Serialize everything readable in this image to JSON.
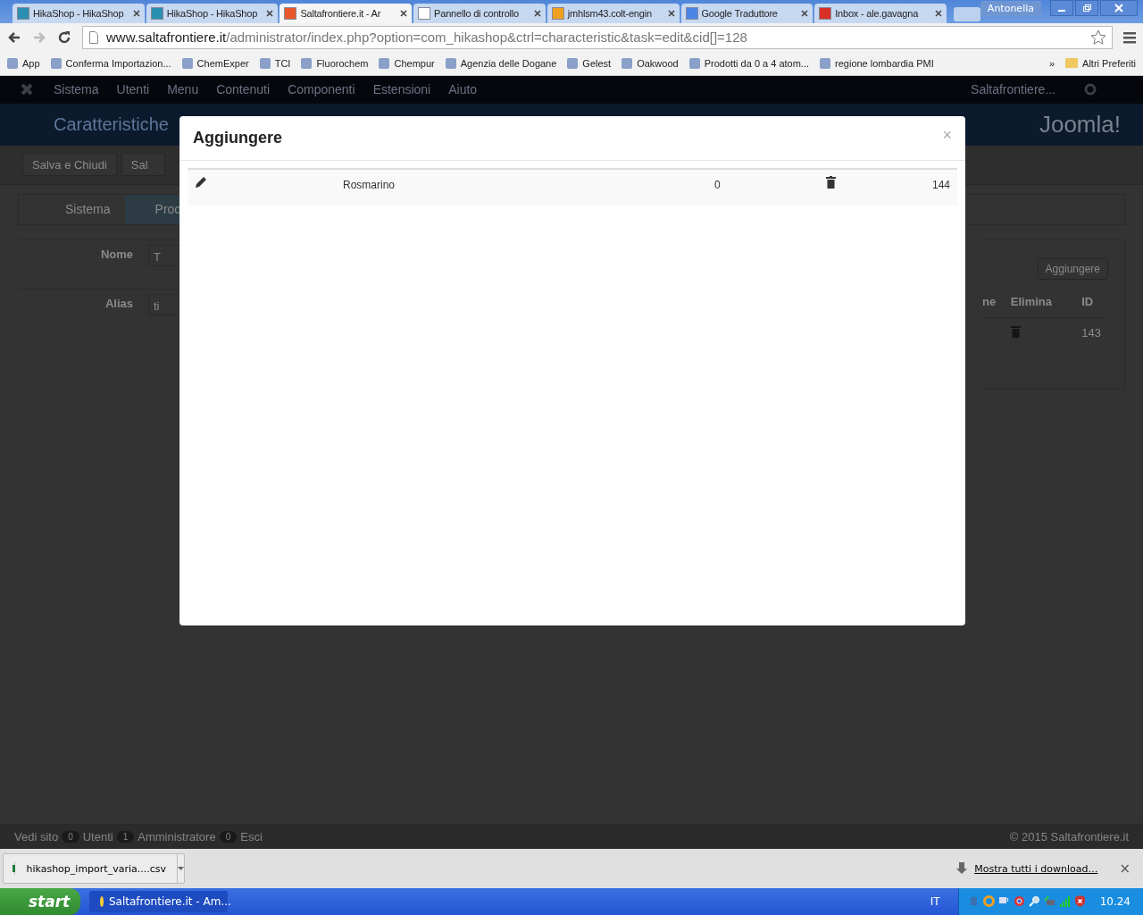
{
  "browser": {
    "tabs": [
      {
        "title": "HikaShop - HikaShop",
        "selected": false
      },
      {
        "title": "HikaShop - HikaShop",
        "selected": false
      },
      {
        "title": "Saltafrontiere.it - Ar",
        "selected": true
      },
      {
        "title": "Pannello di controllo",
        "selected": false
      },
      {
        "title": "jmhlsm43.colt-engin",
        "selected": false
      },
      {
        "title": "Google Traduttore",
        "selected": false
      },
      {
        "title": "Inbox - ale.gavagna",
        "selected": false
      }
    ],
    "profile": "Antonella",
    "url": {
      "host": "www.saltafrontiere.it",
      "path": "/administrator/index.php?option=com_hikashop&ctrl=characteristic&task=edit&cid[]=128"
    },
    "bookmarks": [
      "App",
      "Conferma Importazion...",
      "ChemExper",
      "TCI",
      "Fluorochem",
      "Chempur",
      "Agenzia delle Dogane",
      "Gelest",
      "Oakwood",
      "Prodotti da 0 a 4 atom...",
      "regione lombardia PMI"
    ],
    "bookmarks_more": "»",
    "other_bookmarks": "Altri Preferiti"
  },
  "admin": {
    "menu": [
      "Sistema",
      "Utenti",
      "Menu",
      "Contenuti",
      "Componenti",
      "Estensioni",
      "Aiuto"
    ],
    "site_link": "Saltafrontiere...",
    "page_title": "Caratteristiche",
    "logo": "Joomla!",
    "toolbar": [
      "Salva e Chiudi",
      "Sal"
    ],
    "tabs": [
      {
        "label": "Sistema",
        "selected": false
      },
      {
        "label": "Proc",
        "selected": true
      }
    ],
    "form": [
      {
        "label": "Nome",
        "value": "T"
      },
      {
        "label": "Alias",
        "value": "ti"
      }
    ],
    "values_panel": {
      "add_button": "Aggiungere",
      "columns": [
        "ne",
        "Elimina",
        "ID"
      ],
      "rows": [
        {
          "id": "143"
        }
      ]
    },
    "status": {
      "view_site": "Vedi sito",
      "visitors": "0",
      "visitors_label": "Utenti",
      "admins": "1",
      "admins_label": "Amministratore",
      "messages": "0",
      "logout": "Esci",
      "copyright": "© 2015 Saltafrontiere.it"
    }
  },
  "modal": {
    "title": "Aggiungere",
    "close": "×",
    "rows": [
      {
        "name": "Rosmarino",
        "ordering": "0",
        "id": "144"
      }
    ]
  },
  "downloads": {
    "file": "hikashop_import_varia....csv",
    "show_all": "Mostra tutti i download…",
    "close": "×"
  },
  "taskbar": {
    "start": "start",
    "windows": [
      "Saltafrontiere.it - Am..."
    ],
    "language": "IT",
    "clock": "10.24"
  }
}
